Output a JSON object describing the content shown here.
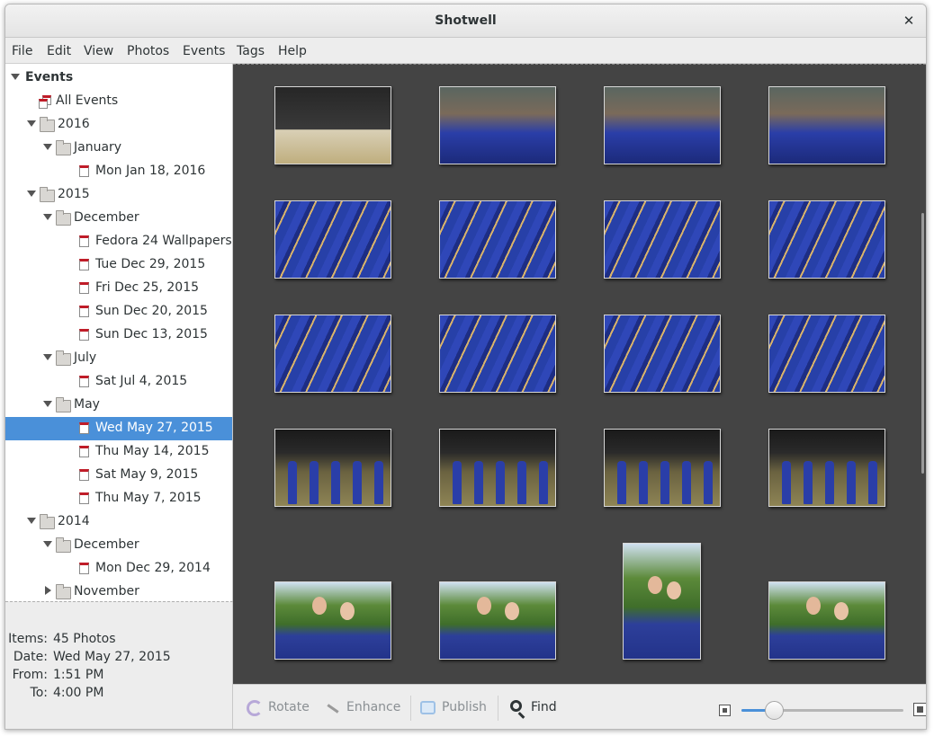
{
  "window": {
    "title": "Shotwell",
    "close_glyph": "✕"
  },
  "menubar": {
    "items": [
      "File",
      "Edit",
      "View",
      "Photos",
      "Events",
      "Tags",
      "Help"
    ]
  },
  "sidebar": {
    "root_label": "Events",
    "all_events": "All Events",
    "tree": [
      {
        "label": "2016",
        "kind": "folder",
        "expanded": true
      },
      {
        "label": "January",
        "kind": "folder",
        "expanded": true
      },
      {
        "label": "Mon Jan 18, 2016",
        "kind": "event"
      },
      {
        "label": "2015",
        "kind": "folder",
        "expanded": true
      },
      {
        "label": "December",
        "kind": "folder",
        "expanded": true
      },
      {
        "label": "Fedora 24 Wallpapers",
        "kind": "event"
      },
      {
        "label": "Tue Dec 29, 2015",
        "kind": "event"
      },
      {
        "label": "Fri Dec 25, 2015",
        "kind": "event"
      },
      {
        "label": "Sun Dec 20, 2015",
        "kind": "event"
      },
      {
        "label": "Sun Dec 13, 2015",
        "kind": "event"
      },
      {
        "label": "July",
        "kind": "folder",
        "expanded": true
      },
      {
        "label": "Sat Jul 4, 2015",
        "kind": "event"
      },
      {
        "label": "May",
        "kind": "folder",
        "expanded": true
      },
      {
        "label": "Wed May 27, 2015",
        "kind": "event",
        "selected": true
      },
      {
        "label": "Thu May 14, 2015",
        "kind": "event"
      },
      {
        "label": "Sat May 9, 2015",
        "kind": "event"
      },
      {
        "label": "Thu May 7, 2015",
        "kind": "event"
      },
      {
        "label": "2014",
        "kind": "folder",
        "expanded": true
      },
      {
        "label": "December",
        "kind": "folder",
        "expanded": true
      },
      {
        "label": "Mon Dec 29, 2014",
        "kind": "event"
      },
      {
        "label": "November",
        "kind": "folder",
        "expanded": false
      }
    ]
  },
  "info": {
    "items_key": "Items:",
    "items_val": "45 Photos",
    "date_key": "Date:",
    "date_val": "Wed May 27, 2015",
    "from_key": "From:",
    "from_val": "1:51 PM",
    "to_key": "To:",
    "to_val": "4:00 PM"
  },
  "photos": [
    {
      "kind": "stage"
    },
    {
      "kind": "crowd"
    },
    {
      "kind": "crowd"
    },
    {
      "kind": "crowd"
    },
    {
      "kind": "gowns"
    },
    {
      "kind": "gowns"
    },
    {
      "kind": "gowns"
    },
    {
      "kind": "gowns"
    },
    {
      "kind": "gowns"
    },
    {
      "kind": "gowns"
    },
    {
      "kind": "gowns"
    },
    {
      "kind": "gowns"
    },
    {
      "kind": "walk"
    },
    {
      "kind": "walk"
    },
    {
      "kind": "walk"
    },
    {
      "kind": "walk"
    },
    {
      "kind": "portrait"
    },
    {
      "kind": "portrait"
    },
    {
      "kind": "portrait-tall"
    },
    {
      "kind": "portrait"
    }
  ],
  "toolbar": {
    "rotate": "Rotate",
    "enhance": "Enhance",
    "publish": "Publish",
    "find": "Find",
    "zoom_level": 0.2
  },
  "colors": {
    "selection": "#4a90d9",
    "viewer_bg": "#444444",
    "gown_blue": "#2a3ea8",
    "event_red": "#c01c28"
  },
  "icons": {
    "rotate": "rotate-icon",
    "enhance": "enhance-icon",
    "publish": "publish-icon",
    "find": "search-icon",
    "zoom_out": "zoom-out-icon",
    "zoom_in": "zoom-in-icon"
  }
}
